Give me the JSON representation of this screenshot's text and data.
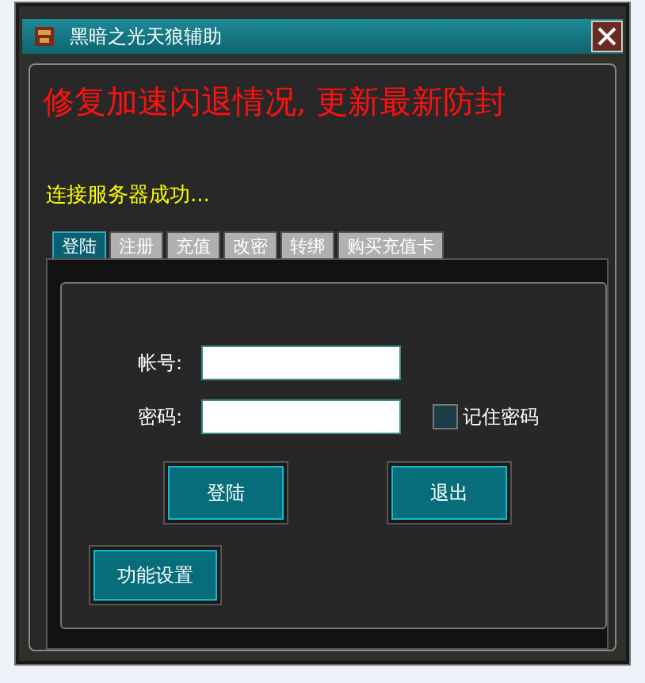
{
  "window": {
    "title": "黑暗之光天狼辅助"
  },
  "banner": "修复加速闪退情况, 更新最新防封",
  "status": "连接服务器成功...",
  "tabs": [
    {
      "label": "登陆",
      "selected": true
    },
    {
      "label": "注册",
      "selected": false
    },
    {
      "label": "充值",
      "selected": false
    },
    {
      "label": "改密",
      "selected": false
    },
    {
      "label": "转绑",
      "selected": false
    },
    {
      "label": "购买充值卡",
      "selected": false
    }
  ],
  "form": {
    "account_label": "帐号:",
    "password_label": "密码:",
    "remember": {
      "label": "记住密码",
      "checked": false
    }
  },
  "buttons": {
    "login": "登陆",
    "exit": "退出",
    "settings": "功能设置"
  }
}
